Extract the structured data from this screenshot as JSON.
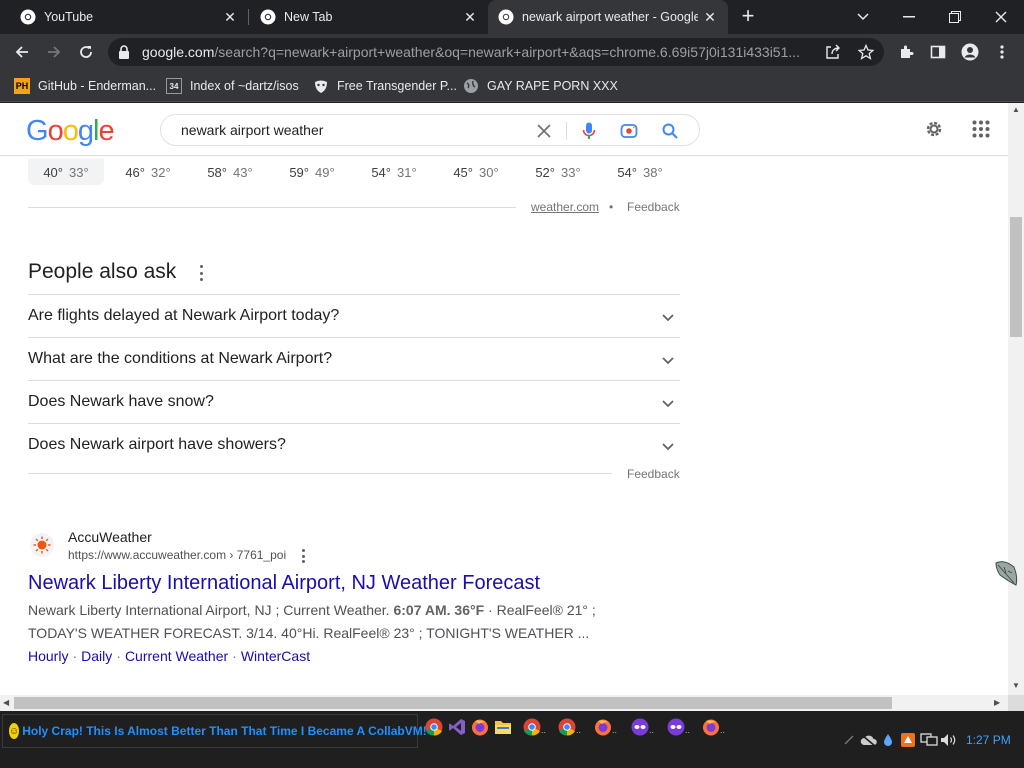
{
  "browser": {
    "tabs": [
      {
        "title": "YouTube",
        "icon": "chrome-icon"
      },
      {
        "title": "New Tab",
        "icon": "chrome-icon"
      },
      {
        "title": "newark airport weather - Google",
        "icon": "google-icon",
        "active": true
      }
    ],
    "omnibox": {
      "host": "google.com",
      "path": "/search?q=newark+airport+weather&oq=newark+airport+&aqs=chrome.6.69i57j0i131i433i51..."
    },
    "bookmarks": [
      {
        "label": "GitHub - Enderman...",
        "icon": "ph-icon"
      },
      {
        "label": "Index of ~dartz/isos",
        "icon": "34-icon"
      },
      {
        "label": "Free Transgender P...",
        "icon": "mask-icon"
      },
      {
        "label": "GAY RAPE PORN XXX",
        "icon": "globe-icon"
      }
    ]
  },
  "google": {
    "query": "newark airport weather",
    "forecast": [
      {
        "hi": "40°",
        "lo": "33°"
      },
      {
        "hi": "46°",
        "lo": "32°"
      },
      {
        "hi": "58°",
        "lo": "43°"
      },
      {
        "hi": "59°",
        "lo": "49°"
      },
      {
        "hi": "54°",
        "lo": "31°"
      },
      {
        "hi": "45°",
        "lo": "30°"
      },
      {
        "hi": "52°",
        "lo": "33°"
      },
      {
        "hi": "54°",
        "lo": "38°"
      }
    ],
    "weather_source": "weather.com",
    "bullet": "•",
    "feedback": "Feedback",
    "paa_title": "People also ask",
    "paa_questions": [
      "Are flights delayed at Newark Airport today?",
      "What are the conditions at Newark Airport?",
      "Does Newark have snow?",
      "Does Newark airport have showers?"
    ],
    "result": {
      "site_name": "AccuWeather",
      "url": "https://www.accuweather.com › 7761_poi",
      "title": "Newark Liberty International Airport, NJ Weather Forecast",
      "snippet1_a": "Newark Liberty International Airport, NJ ; Current Weather. ",
      "snippet1_b": "6:07 AM. 36°F",
      "snippet1_c": " · RealFeel® 21° ;",
      "snippet2": "TODAY'S WEATHER FORECAST. 3/14. 40°Hi. RealFeel® 23° ; TONIGHT'S WEATHER ...",
      "sitelinks": [
        "Hourly",
        "Daily",
        "Current Weather",
        "WinterCast"
      ],
      "sitelink_sep": "·"
    }
  },
  "taskbar": {
    "start_text": "Holy Crap! This Is Almost Better Than That Time I Became A CollabVM!",
    "start_icon": "smiley-icon",
    "clock": "1:27 PM",
    "accent": "#1e90ff"
  }
}
